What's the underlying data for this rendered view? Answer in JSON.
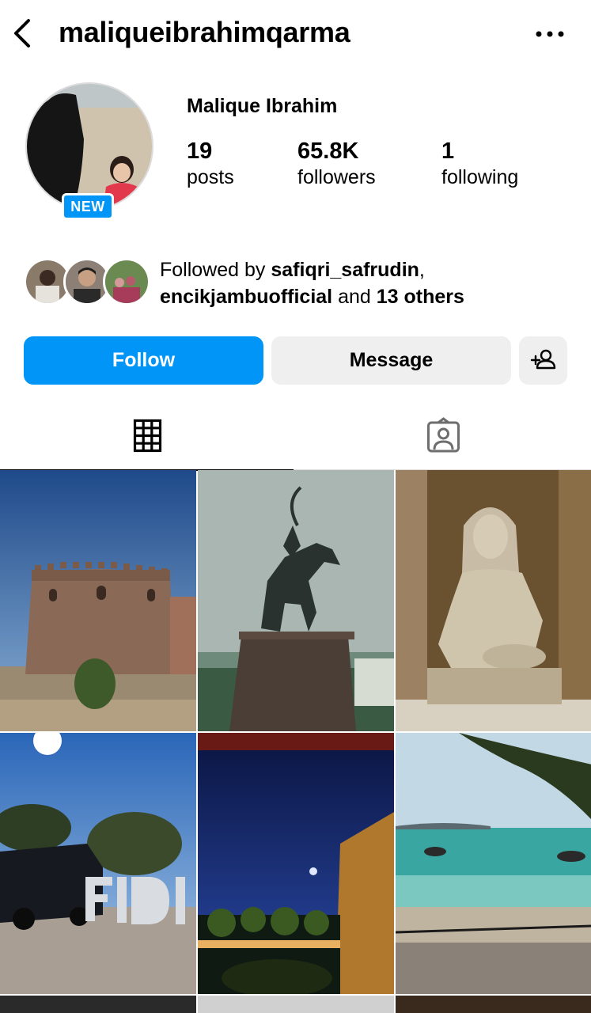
{
  "header": {
    "username": "maliqueibrahimqarma",
    "back_icon": "chevron-left-icon",
    "more_icon": "more-horizontal-icon"
  },
  "profile": {
    "display_name": "Malique Ibrahim",
    "badge": "NEW",
    "stats": {
      "posts": {
        "value": "19",
        "label": "posts"
      },
      "followers": {
        "value": "65.8K",
        "label": "followers"
      },
      "following": {
        "value": "1",
        "label": "following"
      }
    }
  },
  "followed_by": {
    "prefix": "Followed by ",
    "user1": "safiqri_safrudin",
    "sep": ",",
    "user2": "encikjambuofficial",
    "middle": " and ",
    "others": "13 others"
  },
  "actions": {
    "follow_label": "Follow",
    "message_label": "Message",
    "suggest_icon": "add-user-icon"
  },
  "tabs": [
    {
      "icon": "grid-icon",
      "active": true
    },
    {
      "icon": "tagged-icon",
      "active": false
    }
  ],
  "colors": {
    "accent": "#0095f6",
    "button_gray": "#efefef",
    "divider": "#dbdbdb"
  }
}
